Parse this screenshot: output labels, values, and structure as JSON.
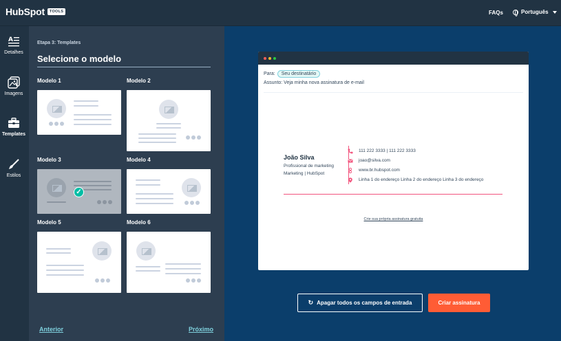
{
  "header": {
    "logo_text": "HubSpot",
    "logo_badge": "TOOLS",
    "faqs_label": "FAQs",
    "language": "Português"
  },
  "sidebar": {
    "items": [
      {
        "label": "Detalhes",
        "icon": "text-align-icon"
      },
      {
        "label": "Imagens",
        "icon": "image-icon"
      },
      {
        "label": "Templates",
        "icon": "briefcase-icon",
        "active": true
      },
      {
        "label": "Estilos",
        "icon": "brush-icon"
      }
    ]
  },
  "panel": {
    "step": "Etapa 3: Templates",
    "title": "Selecione o modelo",
    "templates": [
      {
        "label": "Modelo 1"
      },
      {
        "label": "Modelo 2"
      },
      {
        "label": "Modelo 3",
        "selected": true
      },
      {
        "label": "Modelo 4"
      },
      {
        "label": "Modelo 5"
      },
      {
        "label": "Modelo 6"
      }
    ],
    "prev_label": "Anterior",
    "next_label": "Próximo"
  },
  "preview": {
    "to_label": "Para:",
    "to_value": "Seu destinatário",
    "subject": "Assunto: Veja minha nova assinatura de e-mail",
    "signature": {
      "name": "João Silva",
      "title": "Profissional de marketing",
      "company": "Marketing | HubSpot",
      "phone": "111 222 3333 | 111 222 3333",
      "email": "joao@silva.com",
      "website": "www.br.hubspot.com",
      "address": "Linha 1 do endereço Linha 2 do endereço Linha 3 do endereço"
    },
    "free_link": "Crie sua própria assinatura gratuita"
  },
  "actions": {
    "clear_label": "Apagar todos os campos de entrada",
    "create_label": "Criar assinatura"
  },
  "colors": {
    "accent_orange": "#ff5c35",
    "accent_pink": "#f2547d",
    "teal": "#00bda5",
    "navy": "#213343",
    "blue": "#0b3e6b"
  }
}
